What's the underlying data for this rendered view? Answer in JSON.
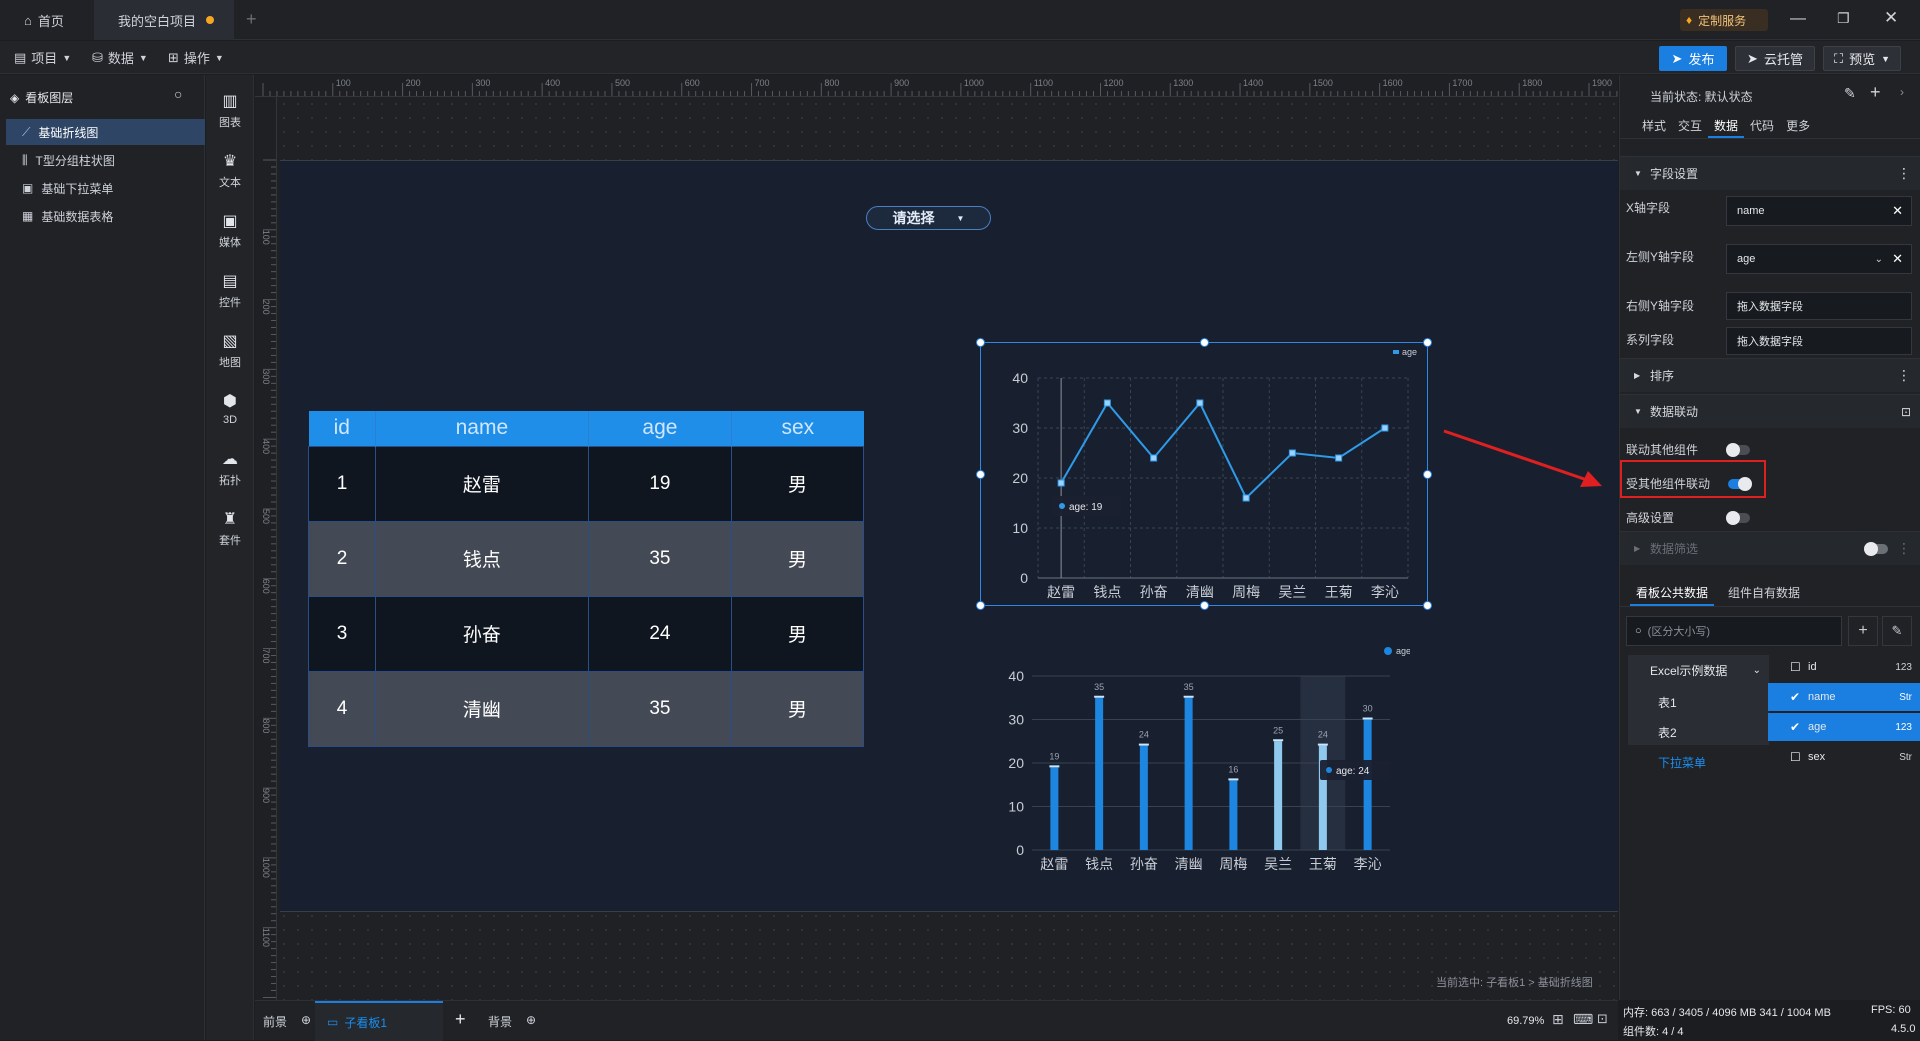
{
  "titlebar": {
    "home_label": "首页",
    "project_label": "我的空白项目",
    "add_tab": "+",
    "custom_service": "定制服务"
  },
  "toolbar": {
    "menus": [
      "项目",
      "数据",
      "操作"
    ],
    "publish": "发布",
    "cloud": "云托管",
    "preview": "预览"
  },
  "layers": {
    "title": "看板图层",
    "items": [
      "基础折线图",
      "T型分组柱状图",
      "基础下拉菜单",
      "基础数据表格"
    ]
  },
  "iconbar": {
    "items": [
      {
        "label": "图表",
        "icon": "bar-chart-icon"
      },
      {
        "label": "文本",
        "icon": "text-icon"
      },
      {
        "label": "媒体",
        "icon": "media-icon"
      },
      {
        "label": "控件",
        "icon": "widget-icon"
      },
      {
        "label": "地图",
        "icon": "map-icon"
      },
      {
        "label": "3D",
        "icon": "cube-icon"
      },
      {
        "label": "拓扑",
        "icon": "topology-icon"
      },
      {
        "label": "套件",
        "icon": "kit-icon"
      }
    ]
  },
  "ruler": {
    "h_labels": [
      "100",
      "200",
      "300",
      "400",
      "500",
      "600",
      "700",
      "800",
      "900",
      "1000",
      "1100",
      "1200",
      "1300",
      "1400",
      "1500",
      "1600",
      "1700",
      "1800",
      "1900"
    ],
    "v_labels": [
      "100",
      "200",
      "300",
      "400",
      "500",
      "600",
      "700",
      "800",
      "900",
      "1000",
      "1100"
    ]
  },
  "canvas": {
    "dropdown_label": "请选择",
    "breadcrumb": "当前选中: 子看板1 > 基础折线图"
  },
  "table": {
    "headers": [
      "id",
      "name",
      "age",
      "sex"
    ],
    "rows": [
      [
        "1",
        "赵雷",
        "19",
        "男"
      ],
      [
        "2",
        "钱点",
        "35",
        "男"
      ],
      [
        "3",
        "孙奋",
        "24",
        "男"
      ],
      [
        "4",
        "清幽",
        "35",
        "男"
      ]
    ]
  },
  "chart_data": [
    {
      "type": "line",
      "categories": [
        "赵雷",
        "钱点",
        "孙奋",
        "清幽",
        "周梅",
        "吴兰",
        "王菊",
        "李沁"
      ],
      "series": [
        {
          "name": "age",
          "values": [
            19,
            35,
            24,
            35,
            16,
            25,
            24,
            30
          ]
        }
      ],
      "ylim": [
        0,
        40
      ],
      "yticks": [
        "0",
        "10",
        "20",
        "30",
        "40"
      ],
      "tooltip": "age: 19",
      "legend": "top-right",
      "grid": true
    },
    {
      "type": "bar",
      "categories": [
        "赵雷",
        "钱点",
        "孙奋",
        "清幽",
        "周梅",
        "吴兰",
        "王菊",
        "李沁"
      ],
      "series": [
        {
          "name": "age",
          "values": [
            19,
            35,
            24,
            35,
            16,
            25,
            24,
            30
          ]
        }
      ],
      "ylim": [
        0,
        40
      ],
      "yticks": [
        "0",
        "10",
        "20",
        "30",
        "40"
      ],
      "tooltip": "age: 24",
      "legend": "top-right",
      "grid": true
    }
  ],
  "rightPanel": {
    "state_label": "当前状态: 默认状态",
    "tabs": [
      "样式",
      "交互",
      "数据",
      "代码",
      "更多"
    ],
    "field_section": "字段设置",
    "x_field_label": "X轴字段",
    "x_field_value": "name",
    "left_y_label": "左侧Y轴字段",
    "left_y_value": "age",
    "right_y_label": "右侧Y轴字段",
    "right_y_placeholder": "拖入数据字段",
    "series_label": "系列字段",
    "series_placeholder": "拖入数据字段",
    "sort_section": "排序",
    "link_section": "数据联动",
    "link_other": "联动其他组件",
    "linked_by_other": "受其他组件联动",
    "advanced": "高级设置",
    "filter_section": "数据筛选",
    "data_tabs": [
      "看板公共数据",
      "组件自有数据"
    ],
    "search_placeholder": "(区分大小写)",
    "sources": [
      "Excel示例数据",
      "表1",
      "表2",
      "下拉菜单"
    ],
    "fields": [
      {
        "name": "id",
        "type": "123",
        "checked": false
      },
      {
        "name": "name",
        "type": "Str",
        "checked": true
      },
      {
        "name": "age",
        "type": "123",
        "checked": true
      },
      {
        "name": "sex",
        "type": "Str",
        "checked": false
      }
    ]
  },
  "statusbar": {
    "front": "前景",
    "board": "子看板1",
    "back": "背景",
    "zoom": "69.79%",
    "memory": "内存: 663 / 3405 / 4096 MB  341 / 1004 MB",
    "fps": "FPS: 60",
    "components": "组件数: 4 / 4",
    "version": "4.5.0"
  },
  "colors": {
    "accent": "#1a7fe0",
    "highlight": "#e02020"
  }
}
